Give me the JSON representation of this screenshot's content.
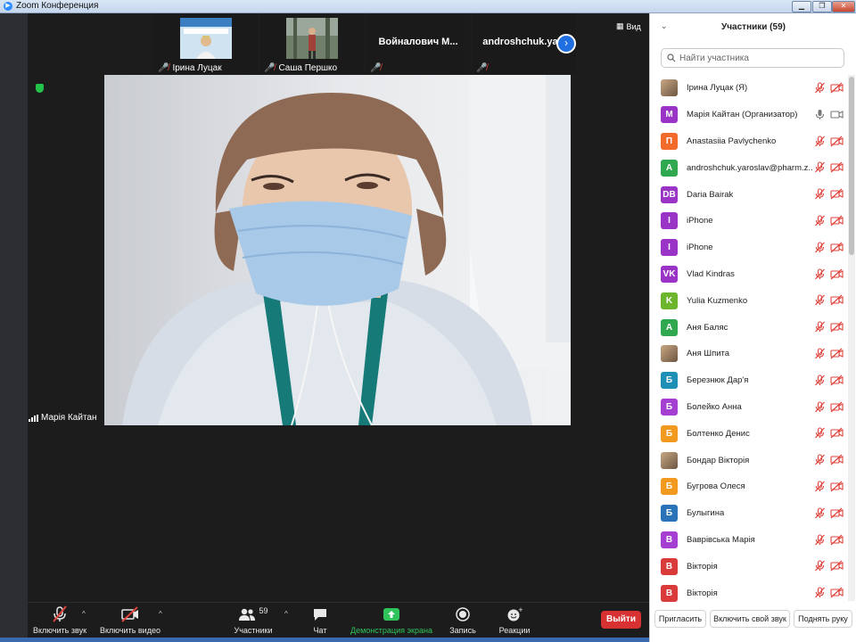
{
  "window": {
    "title": "Zoom Конференция",
    "app_icon": "zoom-logo"
  },
  "thumbnails": [
    {
      "name": "Ірина Луцак",
      "has_photo": true
    },
    {
      "name": "Саша Першко",
      "has_photo": true
    },
    {
      "name": "Войналович М...",
      "has_photo": false
    },
    {
      "name": "androshchuk.ya...",
      "has_photo": false
    }
  ],
  "view_label": "Вид",
  "active_speaker": "Марія Кайтан",
  "toolbar": {
    "unmute": "Включить звук",
    "start_video": "Включить видео",
    "participants": "Участники",
    "participants_count": "59",
    "chat": "Чат",
    "share_screen": "Демонстрация экрана",
    "record": "Запись",
    "reactions": "Реакции",
    "leave": "Выйти"
  },
  "panel": {
    "title": "Участники (59)",
    "search_placeholder": "Найти участника",
    "participants": [
      {
        "name": "Ірина Луцак (Я)",
        "initials": "",
        "color": "#8b6f55",
        "photo": true,
        "audio": "muted",
        "video": "off"
      },
      {
        "name": "Марія Кайтан (Организатор)",
        "initials": "M",
        "color": "#9a34c7",
        "photo": false,
        "audio": "on",
        "video": "on"
      },
      {
        "name": "Anastasiia Pavlychenko",
        "initials": "П",
        "color": "#f26b2a",
        "photo": false,
        "audio": "muted",
        "video": "off"
      },
      {
        "name": "androshchuk.yaroslav@pharm.z...",
        "initials": "A",
        "color": "#2fa84f",
        "photo": false,
        "audio": "muted",
        "video": "off"
      },
      {
        "name": "Daria Bairak",
        "initials": "DB",
        "color": "#9a34c7",
        "photo": false,
        "audio": "muted",
        "video": "off"
      },
      {
        "name": "iPhone",
        "initials": "I",
        "color": "#9a34c7",
        "photo": false,
        "audio": "muted",
        "video": "off"
      },
      {
        "name": "iPhone",
        "initials": "I",
        "color": "#9a34c7",
        "photo": false,
        "audio": "muted",
        "video": "off"
      },
      {
        "name": "Vlad Kindras",
        "initials": "VK",
        "color": "#9a34c7",
        "photo": false,
        "audio": "muted",
        "video": "off"
      },
      {
        "name": "Yulia Kuzmenko",
        "initials": "K",
        "color": "#6cb52d",
        "photo": false,
        "audio": "muted",
        "video": "off"
      },
      {
        "name": "Аня Баляс",
        "initials": "A",
        "color": "#2fa84f",
        "photo": false,
        "audio": "muted",
        "video": "off"
      },
      {
        "name": "Аня Шпита",
        "initials": "",
        "color": "#c9a883",
        "photo": true,
        "audio": "muted",
        "video": "off"
      },
      {
        "name": "Березнюк Дар'я",
        "initials": "Б",
        "color": "#1e8fb5",
        "photo": false,
        "audio": "muted",
        "video": "off"
      },
      {
        "name": "Болейко Анна",
        "initials": "Б",
        "color": "#a43fd1",
        "photo": false,
        "audio": "muted",
        "video": "off"
      },
      {
        "name": "Болтенко Денис",
        "initials": "Б",
        "color": "#f29a1f",
        "photo": false,
        "audio": "muted",
        "video": "off"
      },
      {
        "name": "Бондар Вікторія",
        "initials": "",
        "color": "#7a5a3a",
        "photo": true,
        "audio": "muted",
        "video": "off"
      },
      {
        "name": "Бугрова Олеся",
        "initials": "Б",
        "color": "#f29a1f",
        "photo": false,
        "audio": "muted",
        "video": "off"
      },
      {
        "name": "Булыгина",
        "initials": "Б",
        "color": "#2a73b8",
        "photo": false,
        "audio": "muted",
        "video": "off"
      },
      {
        "name": "Ваврівська Марія",
        "initials": "В",
        "color": "#a43fd1",
        "photo": false,
        "audio": "muted",
        "video": "off"
      },
      {
        "name": "Вікторія",
        "initials": "В",
        "color": "#d93a3a",
        "photo": false,
        "audio": "muted",
        "video": "off"
      },
      {
        "name": "Вікторія",
        "initials": "В",
        "color": "#d93a3a",
        "photo": false,
        "audio": "muted",
        "video": "off"
      }
    ],
    "invite": "Пригласить",
    "unmute_self": "Включить свой звук",
    "raise_hand": "Поднять руку"
  }
}
